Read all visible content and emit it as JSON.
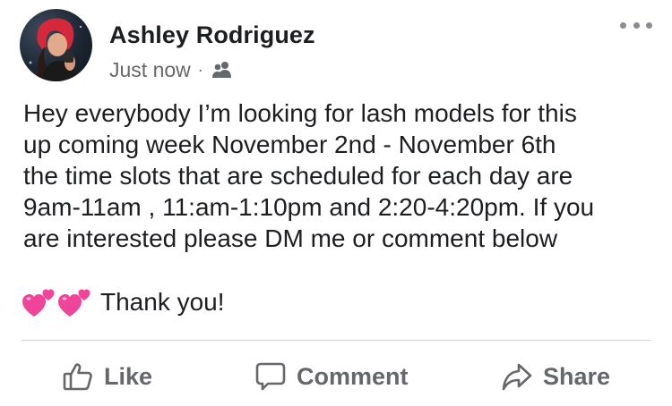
{
  "post": {
    "author": "Ashley Rodriguez",
    "timestamp": "Just now",
    "separator": "·",
    "audience_icon": "friends-icon",
    "body": "Hey everybody I’m looking for lash models for this\nup coming week November 2nd - November 6th\nthe time slots that are scheduled for each day are\n9am-11am , 11:am-1:10pm and 2:20-4:20pm. If you\nare interested please DM me or comment below",
    "emoji": "two-hearts-icon",
    "closing": "Thank you!"
  },
  "actions": {
    "like": "Like",
    "comment": "Comment",
    "share": "Share"
  },
  "colors": {
    "text_primary": "#1c1e21",
    "text_secondary": "#65676b",
    "divider": "#ced0d4",
    "heart_pink": "#f0449a"
  }
}
